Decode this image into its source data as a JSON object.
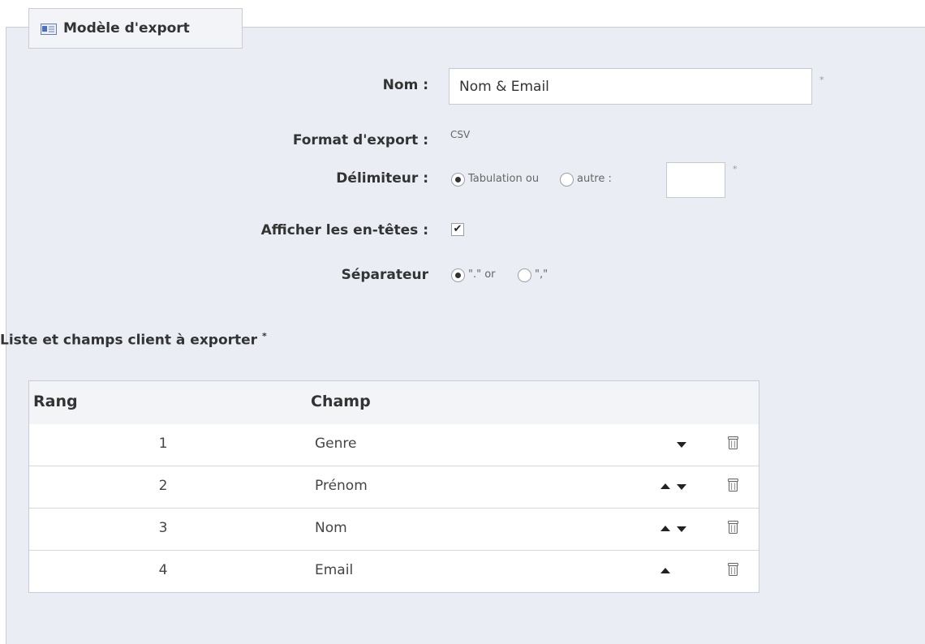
{
  "legend": {
    "title": "Modèle d'export",
    "icon": "contact-card-icon"
  },
  "form": {
    "name_label": "Nom :",
    "name_value": "Nom & Email",
    "required_mark": "*",
    "format_label": "Format d'export :",
    "format_value": "CSV",
    "delimiter_label": "Délimiteur :",
    "delimiter_tab": "Tabulation ou",
    "delimiter_other": "autre :",
    "delimiter_value": "",
    "headers_label": "Afficher les en-têtes :",
    "headers_checked": true,
    "separator_label": "Séparateur",
    "separator_dot": "\".\" or",
    "separator_comma": "\",\""
  },
  "fields_section": {
    "title": "Liste et champs client à exporter",
    "required_mark": "*"
  },
  "table": {
    "headers": {
      "rank": "Rang",
      "field": "Champ"
    },
    "rows": [
      {
        "rank": "1",
        "field": "Genre",
        "up": false,
        "down": true
      },
      {
        "rank": "2",
        "field": "Prénom",
        "up": true,
        "down": true
      },
      {
        "rank": "3",
        "field": "Nom",
        "up": true,
        "down": true
      },
      {
        "rank": "4",
        "field": "Email",
        "up": true,
        "down": false
      }
    ]
  }
}
